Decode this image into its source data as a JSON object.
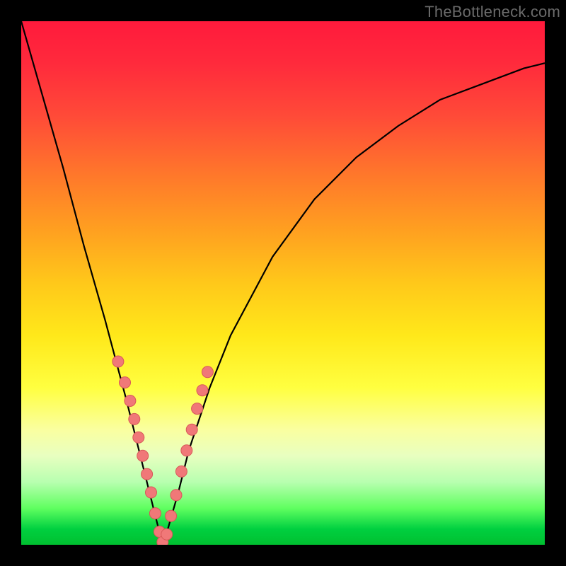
{
  "watermark": "TheBottleneck.com",
  "chart_data": {
    "type": "line",
    "title": "",
    "xlabel": "",
    "ylabel": "",
    "xlim": [
      0,
      100
    ],
    "ylim": [
      0,
      100
    ],
    "note": "Axes are unlabeled; values are estimated percentages read from the curve geometry. y represents bottleneck intensity (higher = worse / red, 0 = green). The curve dips to ~0 around x≈27 (optimal pairing).",
    "series": [
      {
        "name": "bottleneck-curve",
        "x": [
          0,
          4,
          8,
          12,
          16,
          20,
          22,
          24,
          26,
          27,
          28,
          30,
          32,
          36,
          40,
          48,
          56,
          64,
          72,
          80,
          88,
          96,
          100
        ],
        "y": [
          100,
          86,
          72,
          57,
          43,
          28,
          20,
          12,
          4,
          0,
          3,
          10,
          18,
          30,
          40,
          55,
          66,
          74,
          80,
          85,
          88,
          91,
          92
        ]
      }
    ],
    "markers": {
      "name": "pink-dots",
      "note": "Small salmon markers clustered along both arms near the valley.",
      "x": [
        18.5,
        19.8,
        20.8,
        21.6,
        22.4,
        23.2,
        24.0,
        24.8,
        25.6,
        26.4,
        27.0,
        27.8,
        28.6,
        29.6,
        30.6,
        31.6,
        32.6,
        33.6,
        34.6,
        35.6
      ],
      "y": [
        35.0,
        31.0,
        27.5,
        24.0,
        20.5,
        17.0,
        13.5,
        10.0,
        6.0,
        2.5,
        0.5,
        2.0,
        5.5,
        9.5,
        14.0,
        18.0,
        22.0,
        26.0,
        29.5,
        33.0
      ]
    },
    "colors": {
      "curve": "#000000",
      "marker_fill": "#f07878",
      "marker_stroke": "#d85858",
      "gradient_top": "#ff1a3c",
      "gradient_bottom": "#00c030"
    }
  }
}
